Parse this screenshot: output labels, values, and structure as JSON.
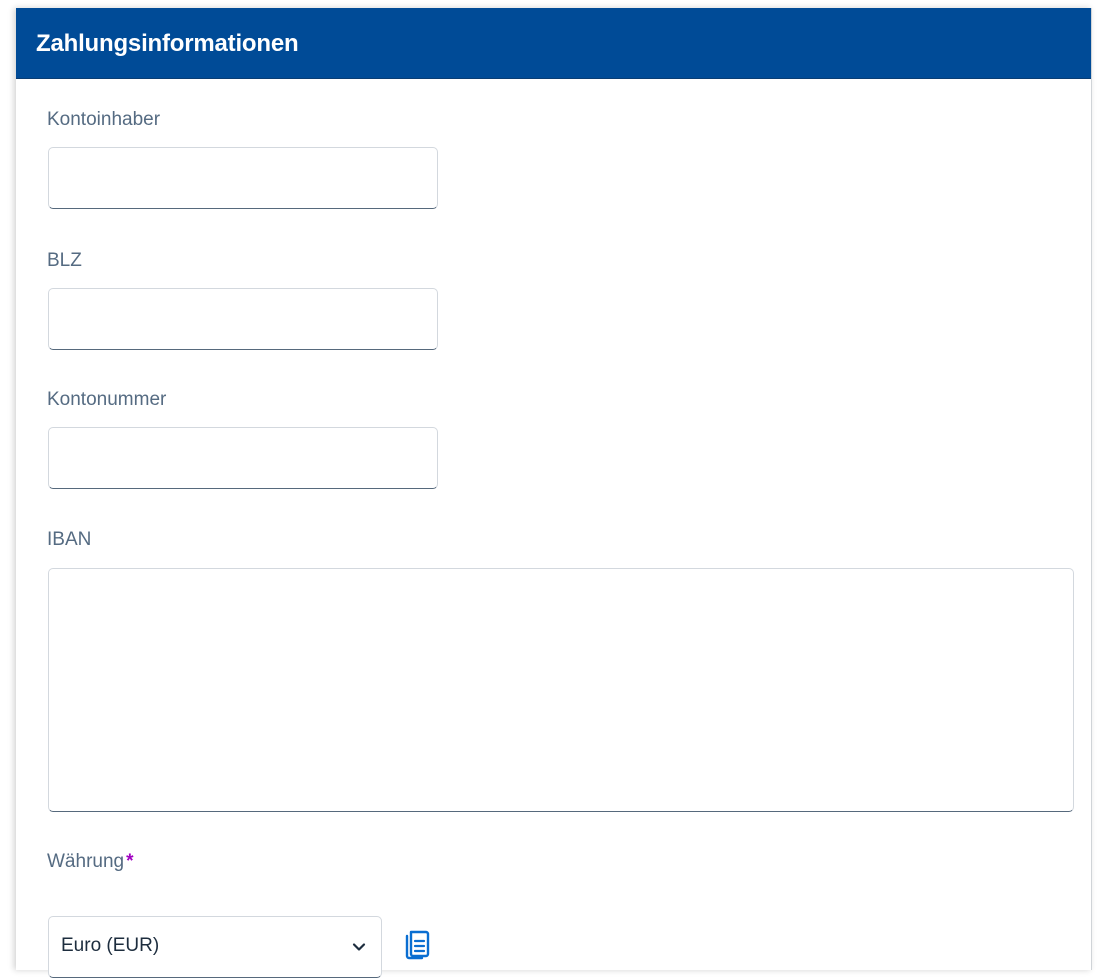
{
  "section": {
    "title": "Zahlungsinformationen",
    "header_color": "#004b97"
  },
  "form": {
    "account_holder": {
      "label": "Kontoinhaber",
      "value": "",
      "placeholder": ""
    },
    "bank_code": {
      "label": "BLZ",
      "value": "",
      "placeholder": ""
    },
    "account_number": {
      "label": "Kontonummer",
      "value": "",
      "placeholder": ""
    },
    "iban": {
      "label": "IBAN",
      "value": "",
      "placeholder": ""
    },
    "currency": {
      "label": "Währung",
      "required_marker": "*",
      "selected": "Euro (EUR)",
      "dropdown_icon": "chevron-down-icon",
      "value_help_icon": "value-help-icon"
    }
  },
  "colors": {
    "label": "#556b82",
    "required": "#a100c2",
    "icon_accent": "#0a6ed1"
  }
}
